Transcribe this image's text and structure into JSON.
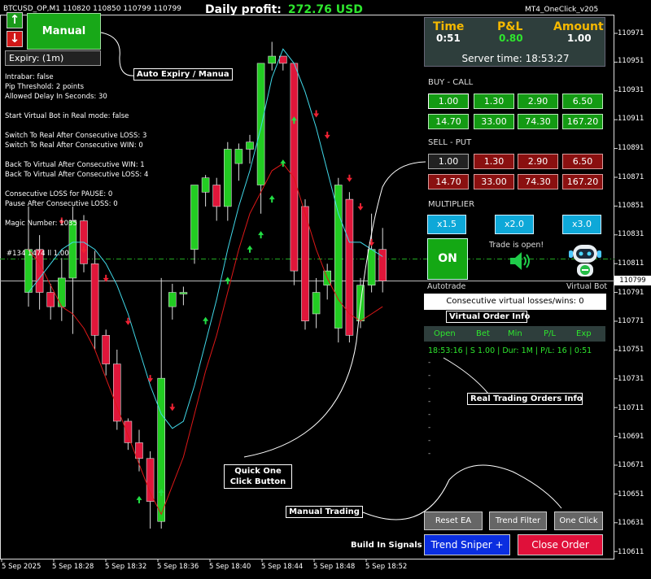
{
  "header": {
    "symbol_info": "BTCUSD_OP,M1  110820 110850 110799 110799",
    "daily_profit_label": "Daily profit:",
    "daily_profit_value": "272.76 USD",
    "version": "MT4_OneClick_v205"
  },
  "left_panel": {
    "up_icon": "arrow-up-icon",
    "down_icon": "arrow-down-icon",
    "up_glyph": "↑",
    "down_glyph": "↓",
    "manual_label": "Manual",
    "expiry_label": "Expiry: (1m)",
    "settings_text": "Intrabar: false\nPip Threshold: 2 points\nAllowed Delay In Seconds: 30\n\nStart Virtual Bot in Real mode: false\n\nSwitch To Real After Consecutive LOSS: 3\nSwitch To Real After Consecutive WIN: 0\n\nBack To Virtual After Consecutive WIN: 1\nBack To Virtual After Consecutive LOSS: 4\n\nConsecutive LOSS for PAUSE: 0\nPause After Consecutive LOSS: 0\n\nMagic Number: 1035",
    "order_line_label": "#134 1474 ll 1.00"
  },
  "annotations": {
    "auto_expiry": "Auto Expiry /  Manua",
    "quick_one_click": "Quick One\nClick Button",
    "manual_trading": "Manual Trading",
    "virtual_order_info": "Virtual Order Info",
    "real_trading_orders_info": "Real Trading Orders Info"
  },
  "info_panel": {
    "time_label": "Time",
    "time_value": "0:51",
    "pl_label": "P&L",
    "pl_value": "0.80",
    "amount_label": "Amount",
    "amount_value": "1.00",
    "server_time": "Server time: 18:53:27"
  },
  "buy_call": {
    "label": "BUY - CALL",
    "amounts": [
      "1.00",
      "1.30",
      "2.90",
      "6.50",
      "14.70",
      "33.00",
      "74.30",
      "167.20"
    ]
  },
  "sell_put": {
    "label": "SELL - PUT",
    "amounts": [
      "1.00",
      "1.30",
      "2.90",
      "6.50",
      "14.70",
      "33.00",
      "74.30",
      "167.20"
    ]
  },
  "multiplier": {
    "label": "MULTIPLIER",
    "options": [
      "x1.5",
      "x2.0",
      "x3.0"
    ]
  },
  "autotrade": {
    "on_label": "ON",
    "trade_status": "Trade is open!",
    "speaker_icon": "speaker-icon",
    "robot_icon": "robot-icon",
    "autotrade_label": "Autotrade",
    "virtual_bot_label": "Virtual Bot",
    "consecutive_text": "Consecutive virtual losses/wins: 0"
  },
  "orders": {
    "columns": [
      "Open",
      "Bet",
      "Min",
      "P/L",
      "Exp"
    ],
    "first_row": "18:53:16 | S 1.00 | Dur: 1M | P/L: 16 |  0:51",
    "placeholder": "-"
  },
  "bottom_buttons": {
    "reset_ea": "Reset EA",
    "trend_filter": "Trend Filter",
    "one_click": "One Click",
    "build_in_signals": "Build In Signals",
    "trend_sniper": "Trend Sniper +",
    "close_order": "Close Order"
  },
  "price_axis": {
    "labels": [
      "110971",
      "110951",
      "110931",
      "110911",
      "110891",
      "110871",
      "110851",
      "110831",
      "110811",
      "110791",
      "110771",
      "110751",
      "110731",
      "110711",
      "110691",
      "110671",
      "110651",
      "110631",
      "110611"
    ],
    "current": "110799"
  },
  "time_axis": {
    "labels": [
      "5 Sep 2025",
      "5 Sep 18:28",
      "5 Sep 18:32",
      "5 Sep 18:36",
      "5 Sep 18:40",
      "5 Sep 18:44",
      "5 Sep 18:48",
      "5 Sep 18:52"
    ]
  },
  "colors": {
    "bull": "#22cc22",
    "bear": "#e0163a",
    "ma_fast": "#40d8e8",
    "ma_slow": "#dd1818",
    "signal_up": "#22dd44",
    "signal_down": "#ee2233",
    "level_line": "#22aa22"
  },
  "chart_data": {
    "type": "candlestick",
    "candles": [
      [
        110791,
        110821,
        110781,
        110851
      ],
      [
        110821,
        110791,
        110779,
        110831
      ],
      [
        110791,
        110781,
        110772,
        110797
      ],
      [
        110781,
        110801,
        110771,
        110815
      ],
      [
        110801,
        110841,
        110762,
        110851
      ],
      [
        110841,
        110811,
        110805,
        110845
      ],
      [
        110811,
        110761,
        110751,
        110820
      ],
      [
        110761,
        110741,
        110733,
        110765
      ],
      [
        110741,
        110701,
        110695,
        110751
      ],
      [
        110701,
        110686,
        110681,
        110703
      ],
      [
        110686,
        110675,
        110666,
        110695
      ],
      [
        110675,
        110645,
        110626,
        110680
      ],
      [
        110631,
        110731,
        110626,
        110801
      ],
      [
        110781,
        110791,
        110772,
        110797
      ],
      [
        110791,
        110791,
        110782,
        110795
      ],
      [
        110821,
        110866,
        110811,
        110866
      ],
      [
        110861,
        110871,
        110851,
        110873
      ],
      [
        110866,
        110851,
        110841,
        110871
      ],
      [
        110851,
        110891,
        110841,
        110896
      ],
      [
        110881,
        110891,
        110869,
        110895
      ],
      [
        110891,
        110896,
        110881,
        110901
      ],
      [
        110866,
        110951,
        110846,
        110951
      ],
      [
        110951,
        110956,
        110946,
        110966
      ],
      [
        110956,
        110951,
        110946,
        110956
      ],
      [
        110951,
        110806,
        110796,
        110951
      ],
      [
        110851,
        110771,
        110765,
        110856
      ],
      [
        110776,
        110791,
        110766,
        110801
      ],
      [
        110796,
        110806,
        110786,
        110811
      ],
      [
        110766,
        110866,
        110756,
        110871
      ],
      [
        110856,
        110761,
        110756,
        110861
      ],
      [
        110771,
        110796,
        110766,
        110801
      ],
      [
        110796,
        110821,
        110791,
        110846
      ],
      [
        110821,
        110799,
        110791,
        110836
      ]
    ],
    "ma_fast": [
      110791,
      110801,
      110811,
      110821,
      110826,
      110826,
      110821,
      110811,
      110796,
      110776,
      110751,
      110726,
      110706,
      110696,
      110701,
      110726,
      110756,
      110786,
      110821,
      110851,
      110876,
      110906,
      110941,
      110961,
      110951,
      110931,
      110906,
      110876,
      110846,
      110826,
      110826,
      110821,
      110816
    ],
    "ma_slow": [
      110821,
      110811,
      110796,
      110781,
      110776,
      110766,
      110751,
      110731,
      110711,
      110691,
      110671,
      110651,
      110636,
      110656,
      110676,
      110706,
      110736,
      110761,
      110791,
      110821,
      110846,
      110861,
      110876,
      110881,
      110871,
      110846,
      110821,
      110801,
      110786,
      110776,
      110771,
      110776,
      110781
    ],
    "signals_up": [
      [
        16,
        110771
      ],
      [
        18,
        110799
      ],
      [
        20,
        110821
      ],
      [
        21,
        110831
      ],
      [
        22,
        110856
      ],
      [
        23,
        110881
      ],
      [
        24,
        110911
      ],
      [
        10,
        110646
      ],
      [
        12,
        110651
      ]
    ],
    "signals_down": [
      [
        3,
        110841
      ],
      [
        5,
        110821
      ],
      [
        7,
        110801
      ],
      [
        9,
        110771
      ],
      [
        11,
        110731
      ],
      [
        13,
        110711
      ],
      [
        26,
        110916
      ],
      [
        27,
        110901
      ],
      [
        29,
        110871
      ],
      [
        30,
        110851
      ],
      [
        31,
        110826
      ]
    ],
    "ylim": [
      110605,
      110985
    ]
  }
}
